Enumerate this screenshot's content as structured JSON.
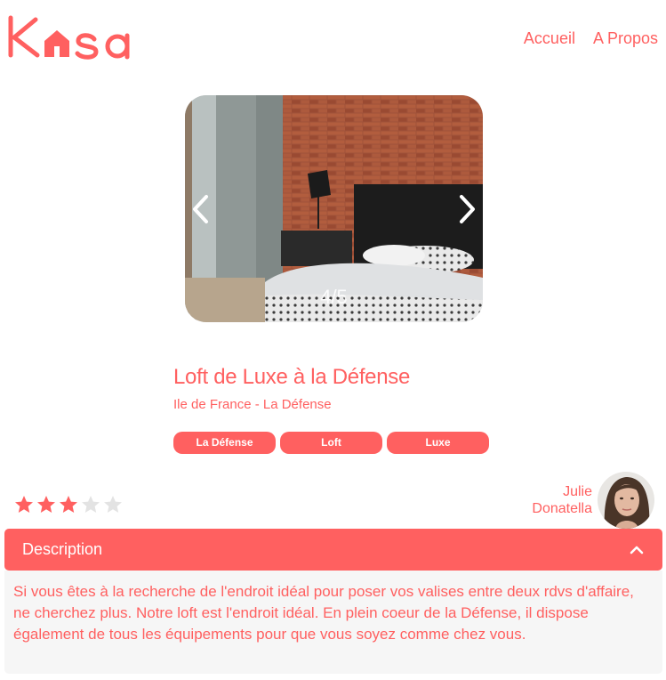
{
  "brand": {
    "name": "Kasa",
    "accent_color": "#FF6060"
  },
  "nav": {
    "items": [
      "Accueil",
      "A Propos"
    ]
  },
  "carousel": {
    "counter": "4/5",
    "icons": {
      "prev": "chevron-left-icon",
      "next": "chevron-right-icon"
    }
  },
  "listing": {
    "title": "Loft de Luxe à la Défense",
    "location": "Ile de France - La Défense",
    "tags": [
      "La Défense",
      "Loft",
      "Luxe"
    ],
    "rating": 3,
    "rating_max": 5
  },
  "host": {
    "first_name": "Julie",
    "last_name": "Donatella"
  },
  "description": {
    "title": "Description",
    "expanded": true,
    "text": "Si vous êtes à la recherche de l'endroit idéal pour poser vos valises entre deux rdvs d'affaire, ne cherchez plus. Notre loft est l'endroit idéal. En plein coeur de la Défense, il dispose également de tous les équipements pour que vous soyez comme chez vous."
  }
}
